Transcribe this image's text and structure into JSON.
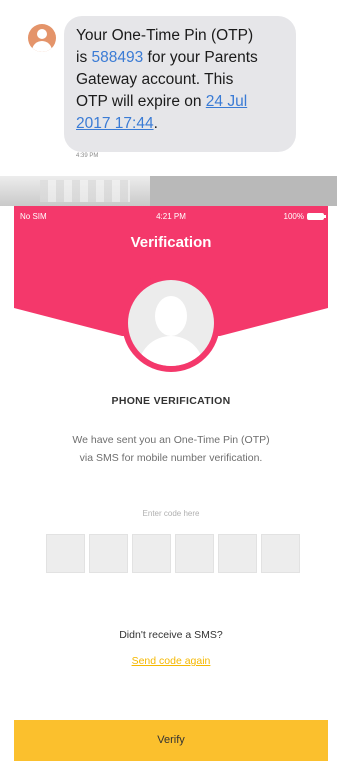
{
  "sms": {
    "line1": "Your One-Time Pin (OTP)",
    "line2_prefix": "is ",
    "otp": "588493",
    "line2_suffix": " for your Parents",
    "line3": "Gateway account. This",
    "line4_prefix": "OTP will expire on ",
    "date_part1": "24 Jul",
    "date_part2": "2017 17:44",
    "end": ".",
    "time": "4:39 PM"
  },
  "status_bar": {
    "carrier": "No SIM",
    "time": "4:21 PM",
    "battery": "100%"
  },
  "screen": {
    "title": "Verification",
    "section_title": "PHONE VERIFICATION",
    "description_line1": "We have sent you an One-Time Pin (OTP)",
    "description_line2": "via SMS for mobile number verification.",
    "code_label": "Enter code here",
    "code_digits": [
      "",
      "",
      "",
      "",
      "",
      ""
    ],
    "resend_question": "Didn't receive a SMS?",
    "resend_link": "Send code again",
    "verify_label": "Verify"
  },
  "colors": {
    "brand_pink": "#f4386b",
    "accent_yellow": "#fbc02d",
    "link_blue": "#3a7bd5"
  },
  "icons": [
    "person-avatar-icon",
    "profile-placeholder-icon",
    "battery-icon"
  ]
}
